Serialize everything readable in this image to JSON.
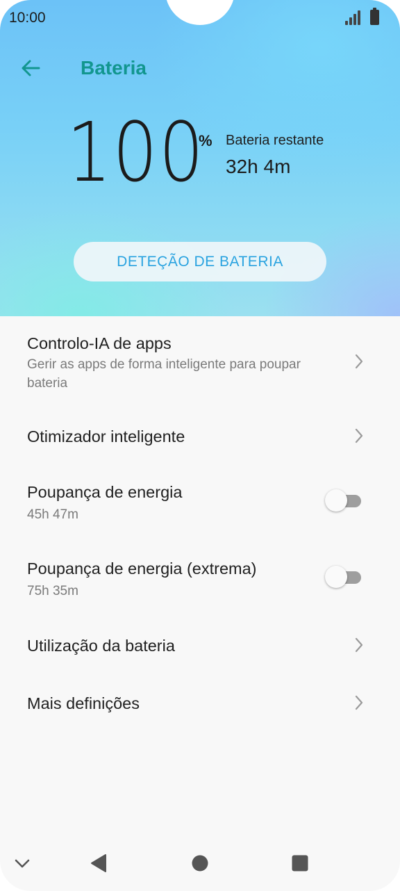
{
  "status_bar": {
    "time": "10:00",
    "icons": [
      "signal-icon",
      "battery-icon"
    ]
  },
  "header": {
    "back_icon": "arrow-left-icon",
    "title": "Bateria",
    "title_color": "#12968f"
  },
  "battery": {
    "percent_value": "100",
    "percent_sign": "%",
    "remaining_label": "Bateria restante",
    "remaining_value": "32h 4m",
    "detect_button_label": "DETEÇÃO DE BATERIA",
    "accent_color": "#2aa3e0"
  },
  "list": {
    "items": [
      {
        "title": "Controlo-IA de apps",
        "subtitle": "Gerir as apps de forma inteligente para poupar bateria",
        "control": "chevron-right-icon"
      },
      {
        "title": "Otimizador inteligente",
        "control": "chevron-right-icon"
      },
      {
        "title": "Poupança de energia",
        "subtitle": "45h 47m",
        "control": "toggle",
        "toggle_on": false
      },
      {
        "title": "Poupança de energia (extrema)",
        "subtitle": "75h 35m",
        "control": "toggle",
        "toggle_on": false
      },
      {
        "title": "Utilização da bateria",
        "control": "chevron-right-icon"
      },
      {
        "title": "Mais definições",
        "control": "chevron-right-icon"
      }
    ]
  },
  "nav_bar": {
    "icons": [
      "chevron-down-icon",
      "back-triangle-icon",
      "home-circle-icon",
      "recents-square-icon"
    ]
  }
}
